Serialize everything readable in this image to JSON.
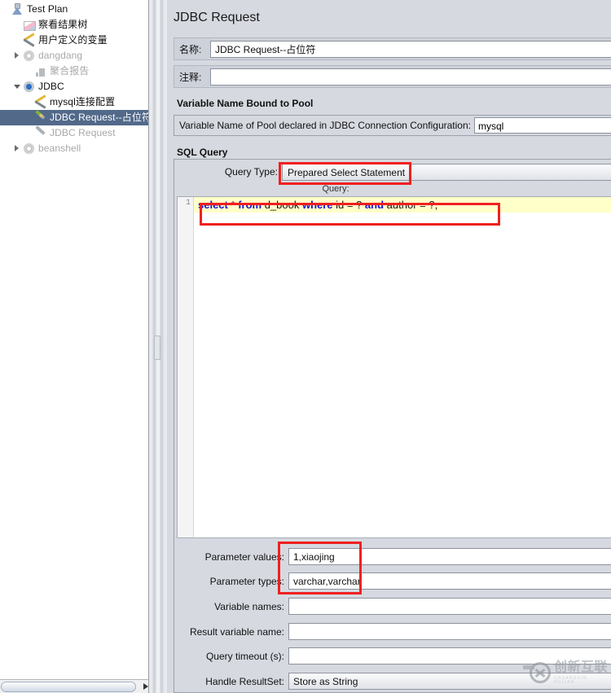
{
  "tree": {
    "items": [
      {
        "label": "Test Plan",
        "icon": "flask-icon",
        "indent": 0,
        "toggle": "none",
        "dim": false,
        "selected": false
      },
      {
        "label": "察看结果树",
        "icon": "view-results-tree-icon",
        "indent": 1,
        "toggle": "none",
        "dim": false,
        "selected": false
      },
      {
        "label": "用户定义的变量",
        "icon": "wrench-icon",
        "indent": 1,
        "toggle": "none",
        "dim": false,
        "selected": false
      },
      {
        "label": "dangdang",
        "icon": "gear-icon",
        "indent": 1,
        "toggle": "collapsed",
        "dim": true,
        "selected": false
      },
      {
        "label": "聚合报告",
        "icon": "bar-chart-icon",
        "indent": 2,
        "toggle": "none",
        "dim": true,
        "selected": false
      },
      {
        "label": "JDBC",
        "icon": "gear-blue-icon",
        "indent": 1,
        "toggle": "expanded",
        "dim": false,
        "selected": false
      },
      {
        "label": "mysql连接配置",
        "icon": "wrench-icon",
        "indent": 2,
        "toggle": "none",
        "dim": false,
        "selected": false
      },
      {
        "label": "JDBC Request--占位符",
        "icon": "pencil-green-icon",
        "indent": 2,
        "toggle": "none",
        "dim": false,
        "selected": true
      },
      {
        "label": "JDBC Request",
        "icon": "pencil-icon",
        "indent": 2,
        "toggle": "none",
        "dim": true,
        "selected": false
      },
      {
        "label": "beanshell",
        "icon": "gear-icon",
        "indent": 1,
        "toggle": "collapsed",
        "dim": true,
        "selected": false
      }
    ],
    "scrollbar": {
      "name": "horizontal-scrollbar"
    }
  },
  "panel": {
    "title": "JDBC Request",
    "name_label": "名称:",
    "name_value": "JDBC Request--占位符",
    "comment_label": "注释:",
    "comment_value": ""
  },
  "pool": {
    "group_title": "Variable Name Bound to Pool",
    "label": "Variable Name of Pool declared in JDBC Connection Configuration:",
    "value": "mysql"
  },
  "sql": {
    "group_title": "SQL Query",
    "query_type_label": "Query Type:",
    "query_type_value": "Prepared Select Statement",
    "query_caption": "Query:",
    "line_number": "1",
    "tokens": [
      {
        "text": "select",
        "kind": "kw"
      },
      {
        "text": " ",
        "kind": "ident"
      },
      {
        "text": "*",
        "kind": "star"
      },
      {
        "text": " ",
        "kind": "ident"
      },
      {
        "text": "from",
        "kind": "kw"
      },
      {
        "text": " d_book ",
        "kind": "ident"
      },
      {
        "text": "where",
        "kind": "kw"
      },
      {
        "text": " id = ? ",
        "kind": "ident"
      },
      {
        "text": "and",
        "kind": "kw"
      },
      {
        "text": " author = ?;",
        "kind": "ident"
      }
    ]
  },
  "params": {
    "parameter_values_label": "Parameter values:",
    "parameter_values": "1,xiaojing",
    "parameter_types_label": "Parameter types:",
    "parameter_types": "varchar,varchar",
    "variable_names_label": "Variable names:",
    "variable_names": "",
    "result_variable_name_label": "Result variable name:",
    "result_variable_name": "",
    "query_timeout_label": "Query timeout (s):",
    "query_timeout": "",
    "handle_resultset_label": "Handle ResultSet:",
    "handle_resultset": "Store as String"
  },
  "watermark": {
    "cn": "创新互联",
    "en": "CHUANGXIN HULIAN"
  },
  "colors": {
    "annotation": "#f02020",
    "selection": "#52698a",
    "keyword": "#1414d6",
    "editor_highlight": "#ffffc9"
  }
}
